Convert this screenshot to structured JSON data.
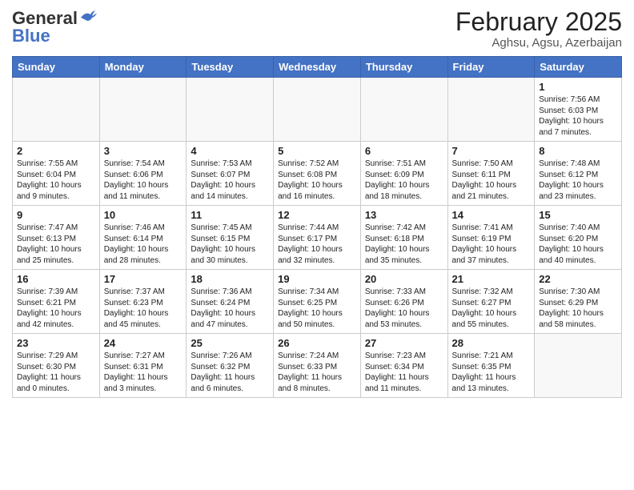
{
  "header": {
    "logo_general": "General",
    "logo_blue": "Blue",
    "month_title": "February 2025",
    "location": "Aghsu, Agsu, Azerbaijan"
  },
  "days_of_week": [
    "Sunday",
    "Monday",
    "Tuesday",
    "Wednesday",
    "Thursday",
    "Friday",
    "Saturday"
  ],
  "weeks": [
    [
      {
        "day": "",
        "info": ""
      },
      {
        "day": "",
        "info": ""
      },
      {
        "day": "",
        "info": ""
      },
      {
        "day": "",
        "info": ""
      },
      {
        "day": "",
        "info": ""
      },
      {
        "day": "",
        "info": ""
      },
      {
        "day": "1",
        "info": "Sunrise: 7:56 AM\nSunset: 6:03 PM\nDaylight: 10 hours\nand 7 minutes."
      }
    ],
    [
      {
        "day": "2",
        "info": "Sunrise: 7:55 AM\nSunset: 6:04 PM\nDaylight: 10 hours\nand 9 minutes."
      },
      {
        "day": "3",
        "info": "Sunrise: 7:54 AM\nSunset: 6:06 PM\nDaylight: 10 hours\nand 11 minutes."
      },
      {
        "day": "4",
        "info": "Sunrise: 7:53 AM\nSunset: 6:07 PM\nDaylight: 10 hours\nand 14 minutes."
      },
      {
        "day": "5",
        "info": "Sunrise: 7:52 AM\nSunset: 6:08 PM\nDaylight: 10 hours\nand 16 minutes."
      },
      {
        "day": "6",
        "info": "Sunrise: 7:51 AM\nSunset: 6:09 PM\nDaylight: 10 hours\nand 18 minutes."
      },
      {
        "day": "7",
        "info": "Sunrise: 7:50 AM\nSunset: 6:11 PM\nDaylight: 10 hours\nand 21 minutes."
      },
      {
        "day": "8",
        "info": "Sunrise: 7:48 AM\nSunset: 6:12 PM\nDaylight: 10 hours\nand 23 minutes."
      }
    ],
    [
      {
        "day": "9",
        "info": "Sunrise: 7:47 AM\nSunset: 6:13 PM\nDaylight: 10 hours\nand 25 minutes."
      },
      {
        "day": "10",
        "info": "Sunrise: 7:46 AM\nSunset: 6:14 PM\nDaylight: 10 hours\nand 28 minutes."
      },
      {
        "day": "11",
        "info": "Sunrise: 7:45 AM\nSunset: 6:15 PM\nDaylight: 10 hours\nand 30 minutes."
      },
      {
        "day": "12",
        "info": "Sunrise: 7:44 AM\nSunset: 6:17 PM\nDaylight: 10 hours\nand 32 minutes."
      },
      {
        "day": "13",
        "info": "Sunrise: 7:42 AM\nSunset: 6:18 PM\nDaylight: 10 hours\nand 35 minutes."
      },
      {
        "day": "14",
        "info": "Sunrise: 7:41 AM\nSunset: 6:19 PM\nDaylight: 10 hours\nand 37 minutes."
      },
      {
        "day": "15",
        "info": "Sunrise: 7:40 AM\nSunset: 6:20 PM\nDaylight: 10 hours\nand 40 minutes."
      }
    ],
    [
      {
        "day": "16",
        "info": "Sunrise: 7:39 AM\nSunset: 6:21 PM\nDaylight: 10 hours\nand 42 minutes."
      },
      {
        "day": "17",
        "info": "Sunrise: 7:37 AM\nSunset: 6:23 PM\nDaylight: 10 hours\nand 45 minutes."
      },
      {
        "day": "18",
        "info": "Sunrise: 7:36 AM\nSunset: 6:24 PM\nDaylight: 10 hours\nand 47 minutes."
      },
      {
        "day": "19",
        "info": "Sunrise: 7:34 AM\nSunset: 6:25 PM\nDaylight: 10 hours\nand 50 minutes."
      },
      {
        "day": "20",
        "info": "Sunrise: 7:33 AM\nSunset: 6:26 PM\nDaylight: 10 hours\nand 53 minutes."
      },
      {
        "day": "21",
        "info": "Sunrise: 7:32 AM\nSunset: 6:27 PM\nDaylight: 10 hours\nand 55 minutes."
      },
      {
        "day": "22",
        "info": "Sunrise: 7:30 AM\nSunset: 6:29 PM\nDaylight: 10 hours\nand 58 minutes."
      }
    ],
    [
      {
        "day": "23",
        "info": "Sunrise: 7:29 AM\nSunset: 6:30 PM\nDaylight: 11 hours\nand 0 minutes."
      },
      {
        "day": "24",
        "info": "Sunrise: 7:27 AM\nSunset: 6:31 PM\nDaylight: 11 hours\nand 3 minutes."
      },
      {
        "day": "25",
        "info": "Sunrise: 7:26 AM\nSunset: 6:32 PM\nDaylight: 11 hours\nand 6 minutes."
      },
      {
        "day": "26",
        "info": "Sunrise: 7:24 AM\nSunset: 6:33 PM\nDaylight: 11 hours\nand 8 minutes."
      },
      {
        "day": "27",
        "info": "Sunrise: 7:23 AM\nSunset: 6:34 PM\nDaylight: 11 hours\nand 11 minutes."
      },
      {
        "day": "28",
        "info": "Sunrise: 7:21 AM\nSunset: 6:35 PM\nDaylight: 11 hours\nand 13 minutes."
      },
      {
        "day": "",
        "info": ""
      }
    ]
  ]
}
